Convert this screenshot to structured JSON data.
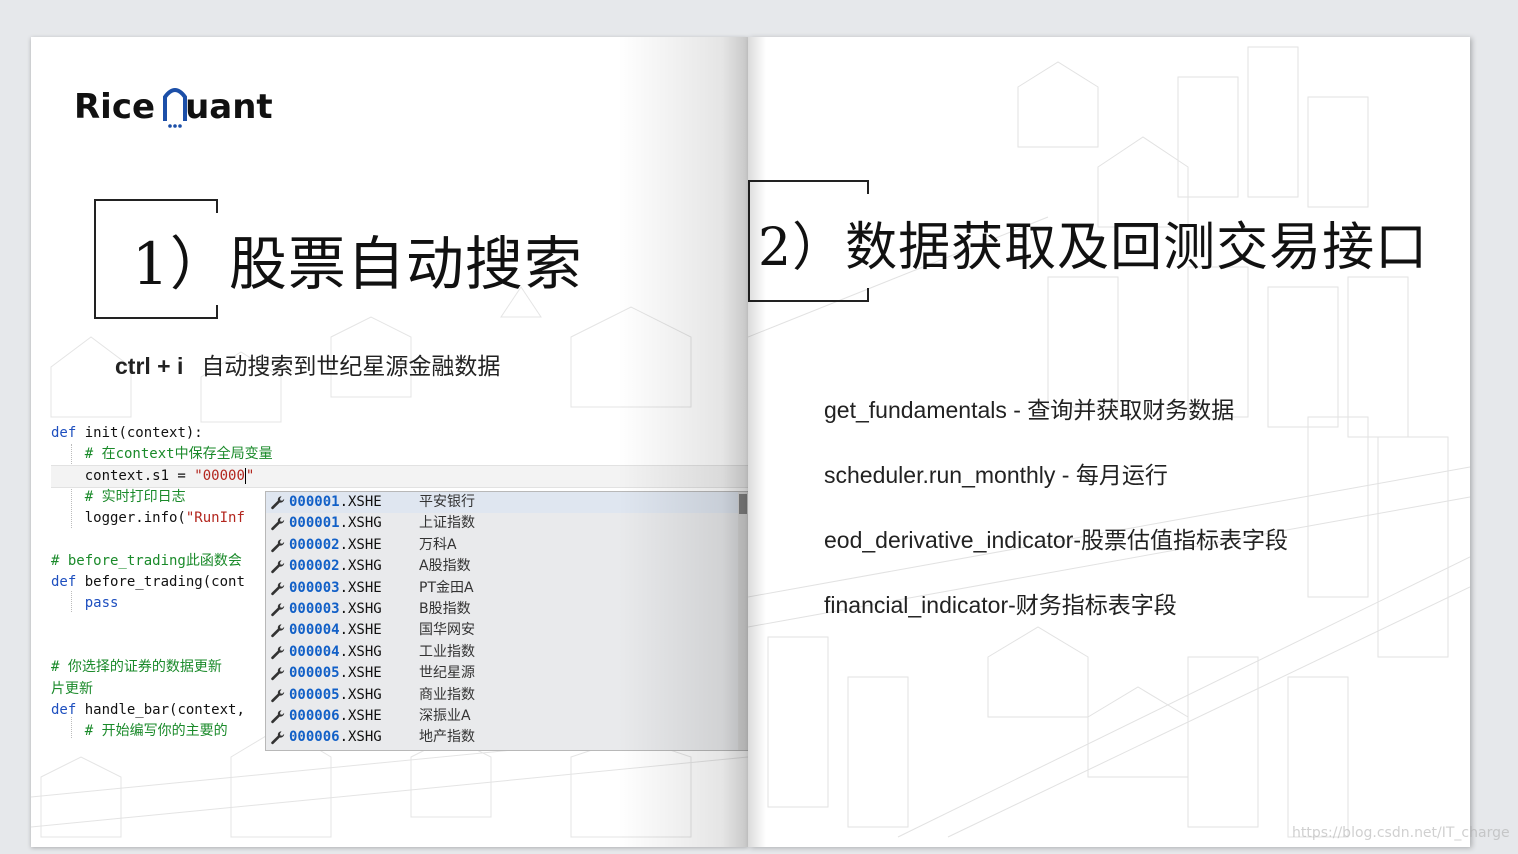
{
  "left_slide": {
    "logo": {
      "text_before": "Rice",
      "text_after": "uant"
    },
    "title": "1）股票自动搜索",
    "subtitle": {
      "shortcut": "ctrl + i",
      "description": "自动搜索到世纪星源金融数据"
    },
    "code": {
      "line1_kw": "def",
      "line1_rest": " init(context):",
      "line2_comment": "# 在context中保存全局变量",
      "line3_code": "context.s1 = ",
      "line3_str": "\"00000",
      "line3_after": "\"",
      "line4_comment": "# 实时打印日志",
      "line5_code": "logger.info(",
      "line5_str": "\"RunInf",
      "line6_comment": "# before_trading此函数会",
      "line7_kw": "def",
      "line7_rest": " before_trading(cont",
      "line8_kw": "pass",
      "line9_comment": "# 你选择的证券的数据更新",
      "line10_comment": "片更新",
      "line11_kw": "def",
      "line11_rest": " handle_bar(context,",
      "line12_comment": "# 开始编写你的主要的"
    },
    "autocomplete": [
      {
        "num": "000001",
        "suffix": ".XSHE",
        "name": "平安银行"
      },
      {
        "num": "000001",
        "suffix": ".XSHG",
        "name": "上证指数"
      },
      {
        "num": "000002",
        "suffix": ".XSHE",
        "name": "万科A"
      },
      {
        "num": "000002",
        "suffix": ".XSHG",
        "name": "A股指数"
      },
      {
        "num": "000003",
        "suffix": ".XSHE",
        "name": "PT金田A"
      },
      {
        "num": "000003",
        "suffix": ".XSHG",
        "name": "B股指数"
      },
      {
        "num": "000004",
        "suffix": ".XSHE",
        "name": "国华网安"
      },
      {
        "num": "000004",
        "suffix": ".XSHG",
        "name": "工业指数"
      },
      {
        "num": "000005",
        "suffix": ".XSHE",
        "name": "世纪星源"
      },
      {
        "num": "000005",
        "suffix": ".XSHG",
        "name": "商业指数"
      },
      {
        "num": "000006",
        "suffix": ".XSHE",
        "name": "深振业A"
      },
      {
        "num": "000006",
        "suffix": ".XSHG",
        "name": "地产指数"
      }
    ]
  },
  "right_slide": {
    "title": "2）数据获取及回测交易接口",
    "apis": [
      {
        "fn": "get_fundamentals - ",
        "desc": "查询并获取财务数据"
      },
      {
        "fn": "scheduler.run_monthly - ",
        "desc": "每月运行"
      },
      {
        "fn": "eod_derivative_indicator-",
        "desc": "股票估值指标表字段"
      },
      {
        "fn": "financial_indicator-",
        "desc": "财务指标表字段"
      }
    ]
  },
  "watermark": "https://blog.csdn.net/IT_charge",
  "colors": {
    "keyword": "#1e4fbf",
    "comment": "#1a8a2a",
    "string": "#b3261e",
    "code_number": "#1260c7"
  }
}
